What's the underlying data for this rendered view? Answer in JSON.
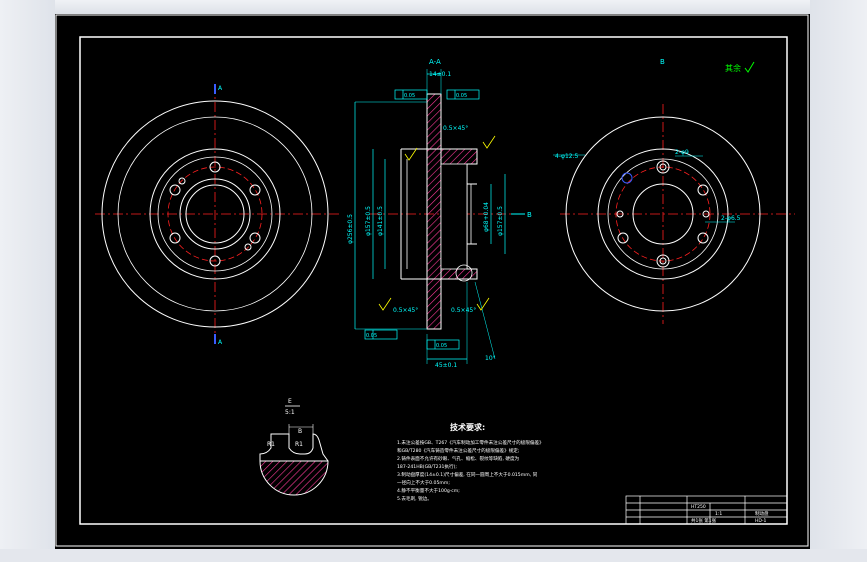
{
  "views": {
    "section_label": "A-A",
    "view_b_label": "B",
    "view_b_note": "其余",
    "section_mark_top": "A",
    "section_mark_bottom": "A",
    "b_arrow_label": "B"
  },
  "dimensions": {
    "thickness_top": "14±0.1",
    "tol_flatness": "0.05",
    "tol_runout": "0.05",
    "chamfer1": "0.5×45°",
    "chamfer2": "0.5×45°",
    "chamfer3": "0.5×45°",
    "dia_outer": "φ256±0.5",
    "dia_inner": "φ157±0.5",
    "dia_141": "φ141±0.5",
    "dia_68": "φ68+0.04",
    "dia_157b": "φ157±0.5",
    "hole_dia": "4-φ12.5",
    "two_holes": "2-φ9",
    "two_holes_b": "2-φ6.5",
    "depth": "45±0.1",
    "angle": "10°",
    "tol_bottom": "0.05",
    "detail_label": "E",
    "detail_scale": "5:1",
    "r1a": "R1",
    "r1b": "R1",
    "detail_b": "B"
  },
  "notes": {
    "title": "技术要求:",
    "lines": [
      "1.未注公差按GB、T267《汽车制动加工零件未注公差尺寸的极限偏差》",
      "和GB/T280《汽车铸造零件未注公差尺寸的极限偏差》规定;",
      "2.铸件表面不允许有砂眼、气孔、缩松、裂纹等缺陷, 硬度为",
      "187-241HB(GB/T231执行);",
      "3.制动盘厚度(14±0.1)尺寸偏差, 在同一圆周上不大于0.015mm, 同",
      "一径向上不大于0.05mm;",
      "4.静不平衡量不大于100g·cm;",
      "5.去毛刺, 锐边。"
    ]
  },
  "title_block": {
    "material": "HT250",
    "scale": "1:1",
    "part_name": "制动盘",
    "sheet": "共1张 第1张",
    "code": "HD-1"
  },
  "colors": {
    "background": "#000000",
    "outline": "#ffffff",
    "center_line": "#ff2020",
    "dimension": "#00ffff",
    "hatch": "#ff3a9a",
    "text_yellow": "#ffff00",
    "note_green": "#00ff00",
    "blue": "#3a5cff"
  }
}
